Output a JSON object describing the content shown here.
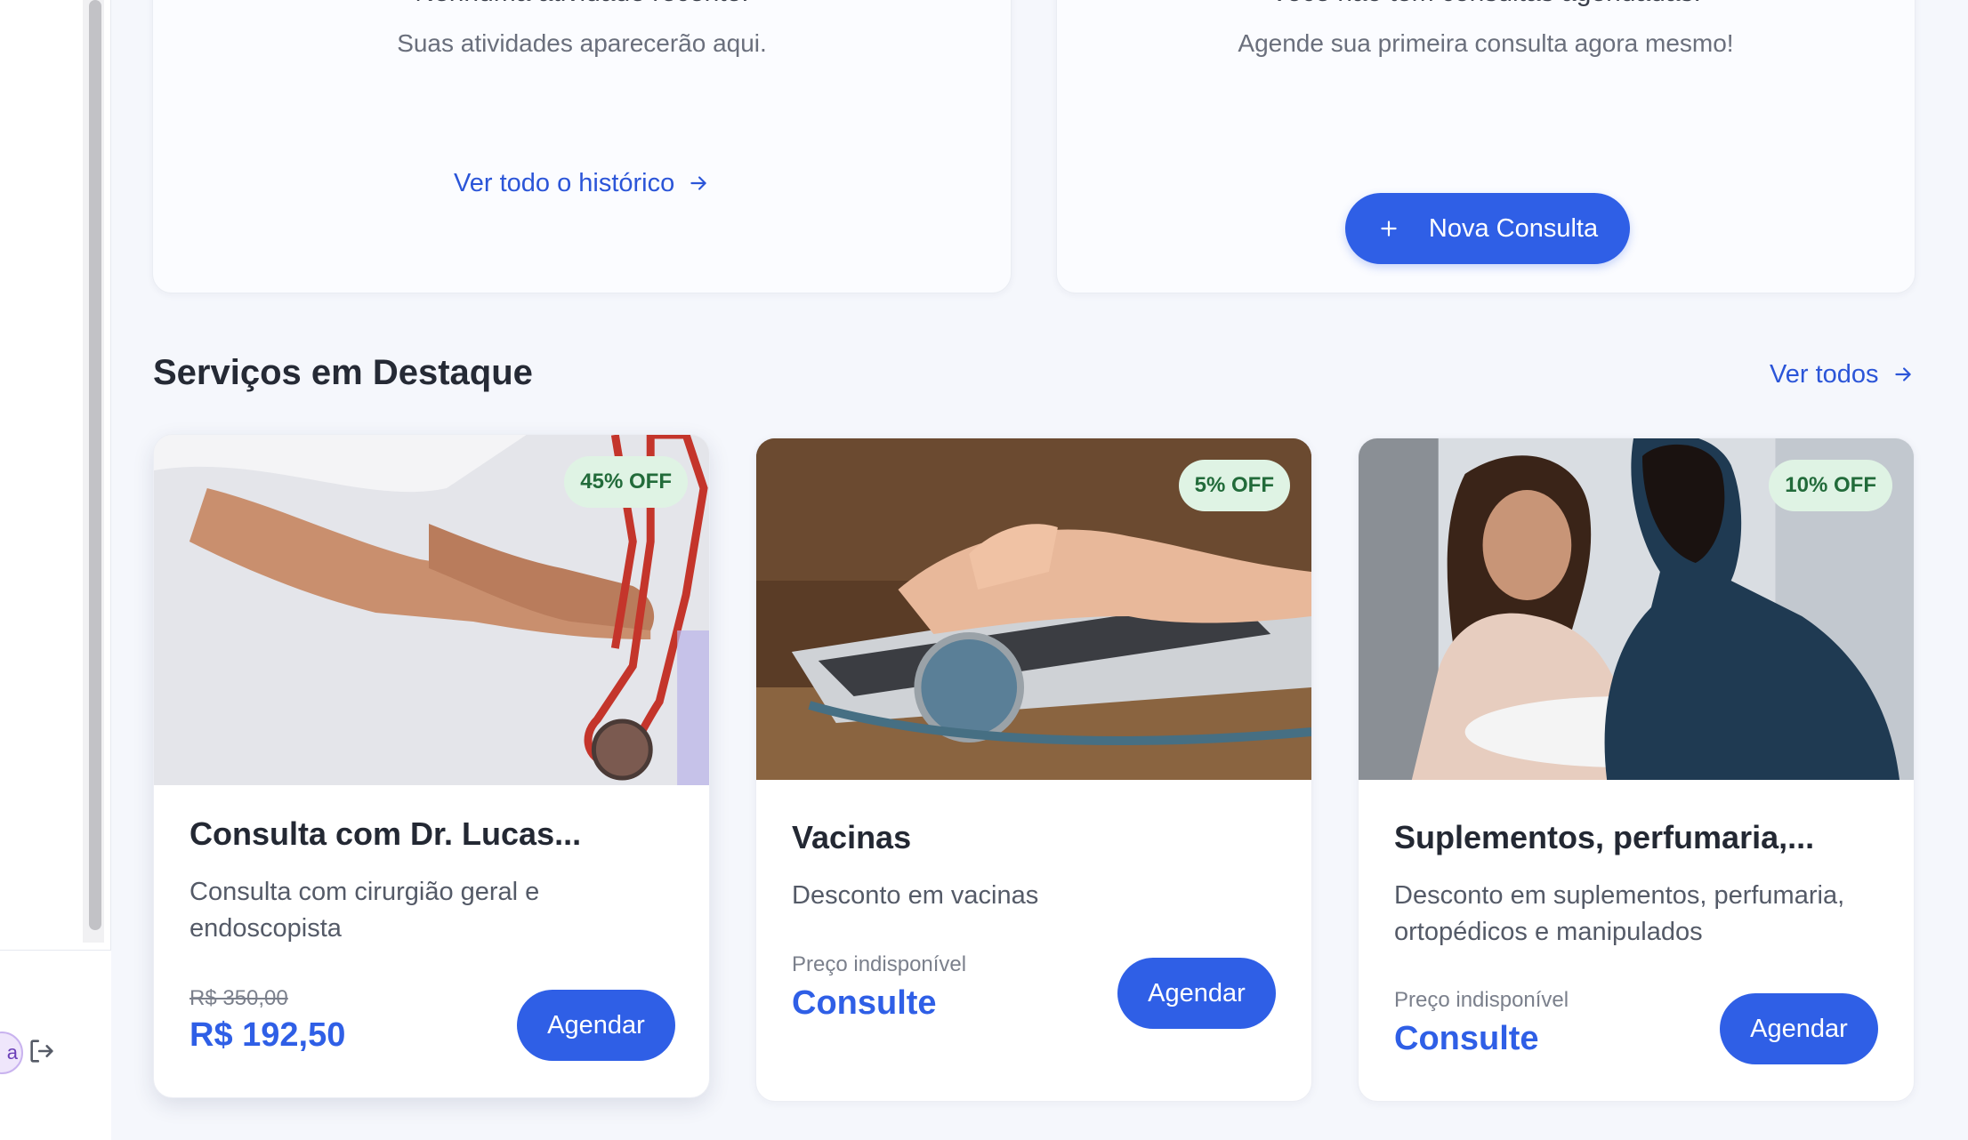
{
  "activity_card": {
    "heading": "Nenhuma atividade recente.",
    "subtitle": "Suas atividades aparecerão aqui.",
    "link": "Ver todo o histórico",
    "link_icon": "arrow-right-icon"
  },
  "appointments_card": {
    "heading": "Você não tem consultas agendadas.",
    "subtitle": "Agende sua primeira consulta agora mesmo!",
    "button": "Nova Consulta",
    "button_icon": "plus-icon"
  },
  "featured": {
    "title": "Serviços em Destaque",
    "see_all": "Ver todos",
    "see_all_icon": "arrow-right-icon",
    "services": [
      {
        "badge": "45% OFF",
        "title": "Consulta com Dr. Lucas...",
        "description": "Consulta com cirurgião geral e endoscopista",
        "old_price": "R$ 350,00",
        "price": "R$ 192,50",
        "button": "Agendar",
        "image": "doctor-with-stethoscope-photo"
      },
      {
        "badge": "5% OFF",
        "title": "Vacinas",
        "description": "Desconto em vacinas",
        "price_label": "Preço indisponível",
        "price": "Consulte",
        "button": "Agendar",
        "image": "laptop-stethoscope-photo"
      },
      {
        "badge": "10% OFF",
        "title": "Suplementos, perfumaria,...",
        "description": "Desconto em suplementos, perfumaria, ortopédicos e manipulados",
        "price_label": "Preço indisponível",
        "price": "Consulte",
        "button": "Agendar",
        "image": "consultation-conversation-photo"
      }
    ]
  },
  "sidebar": {
    "avatar_initial": "a",
    "logout_icon": "logout-icon"
  },
  "colors": {
    "primary": "#2f5fe6",
    "badge_bg": "#dff3e4",
    "badge_text": "#226b3a",
    "background": "#f5f7fc"
  }
}
